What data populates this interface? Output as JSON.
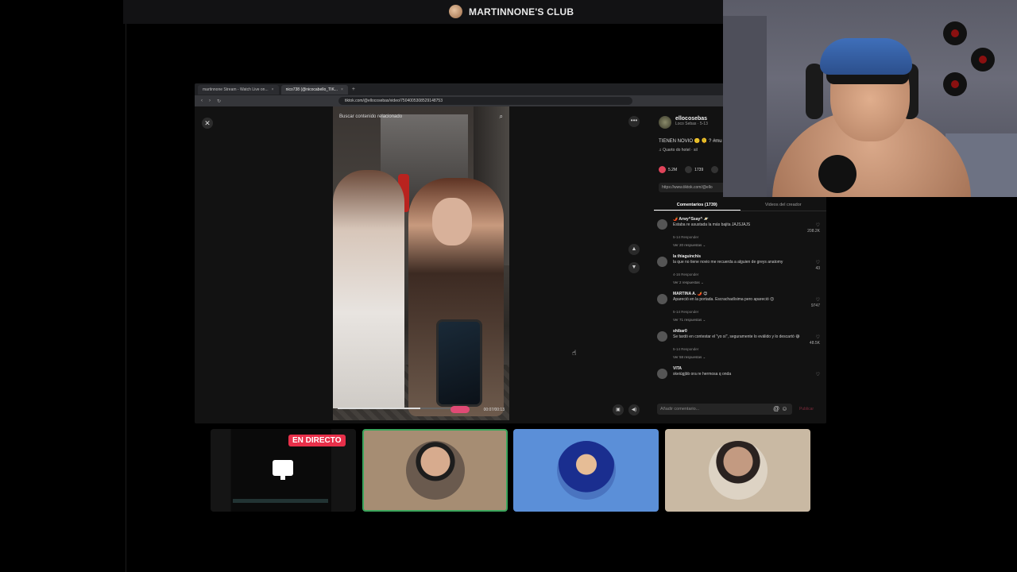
{
  "server": {
    "title": "MARTINNONE'S CLUB"
  },
  "browser": {
    "tabs": [
      {
        "label": "martinnone Stream - Watch Live on..."
      },
      {
        "label": "nico738 (@nicocabello_TIK..."
      }
    ],
    "url": "tiktok.com/@ellocosebas/video/7504005308529148753"
  },
  "tiktok": {
    "search_placeholder": "Buscar contenido relacionado",
    "video_time": "00:07/00:13",
    "progress": 0.63,
    "creator": {
      "name": "ellocosebas",
      "sub": "Loco Sebas · 5-13"
    },
    "caption": "TIENEN NOVIO 🙂 🫠 ? #mu",
    "music": "♫  Quarto do hotel · sil",
    "stats": {
      "likes": "5.2M",
      "comments": "1739",
      "saves": ""
    },
    "link": "https://www.tiktok.com/@ello",
    "tab_comments": "Comentarios (1739)",
    "tab_videos": "Videos del creador",
    "comments": [
      {
        "user": "🌶️ Arwy^Ssay^ 🪐",
        "text": "Estaba re asustada la más bajita JAJSJAJS",
        "meta": "5-14    Responder",
        "replies": "Ver 20 respuestas ⌄",
        "likes": "208.2K"
      },
      {
        "user": "la thiaguinchis",
        "text": "la que no tiene novio me recuerda a alguien de greys anatomy",
        "meta": "4-16    Responder",
        "replies": "Ver 2 respuestas ⌄",
        "likes": "43"
      },
      {
        "user": "MARTINA A. 🌶️ 😊",
        "text": "Apareció en la portada. Escrachadísima pero apareció 😊",
        "meta": "5-14    Responder",
        "replies": "Ver 71 respuestas ⌄",
        "likes": "9747"
      },
      {
        "user": "shibar0",
        "text": "Se tardó en contestar el \"yo sí\", seguramente lo eválido y lo descartó 😅",
        "meta": "5-14    Responder",
        "replies": "Ver 58 respuestas ⌄",
        "likes": "48.5K"
      },
      {
        "user": "VITA",
        "text": "skeiúgjbb ora re hermosa q onda",
        "meta": "",
        "replies": "",
        "likes": ""
      }
    ],
    "comment_placeholder": "Añadir comentario...",
    "post_label": "Publicar"
  },
  "tiles": {
    "live_badge": "EN DIRECTO"
  },
  "icons": {
    "close": "close-icon",
    "more": "more-icon",
    "up": "chevron-up-icon",
    "down": "chevron-down-icon"
  },
  "colors": {
    "live": "#e8304a",
    "speaking": "#3ba55c",
    "heart": "#e0445a"
  }
}
